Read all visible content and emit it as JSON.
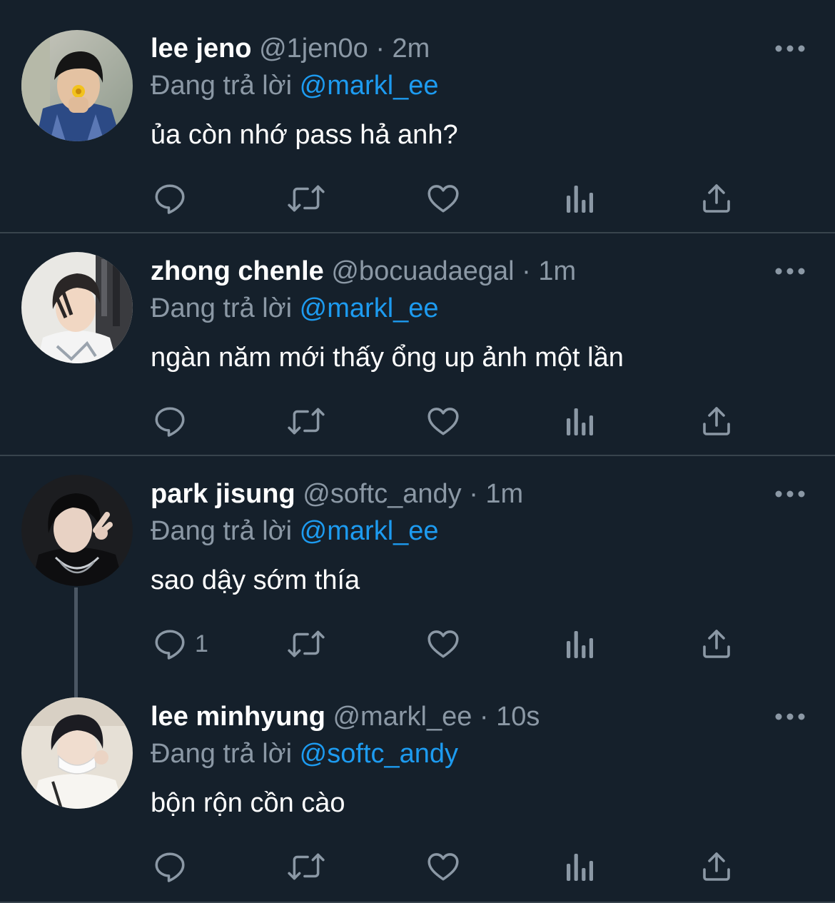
{
  "tweets": [
    {
      "name": "lee jeno",
      "handle": "@1jen0o",
      "dot": "·",
      "time": "2m",
      "reply_prefix": "Đang trả lời",
      "reply_to": "@markl_ee",
      "text": "ủa còn nhớ pass hả anh?",
      "reply_count": ""
    },
    {
      "name": "zhong chenle",
      "handle": "@bocuadaegal",
      "dot": "·",
      "time": "1m",
      "reply_prefix": "Đang trả lời",
      "reply_to": "@markl_ee",
      "text": "ngàn năm mới thấy ổng up ảnh một lần",
      "reply_count": ""
    },
    {
      "name": "park jisung",
      "handle": "@softc_andy",
      "dot": "·",
      "time": "1m",
      "reply_prefix": "Đang trả lời",
      "reply_to": "@markl_ee",
      "text": "sao dậy sớm thía",
      "reply_count": "1"
    },
    {
      "name": "lee minhyung",
      "handle": "@markl_ee",
      "dot": "·",
      "time": "10s",
      "reply_prefix": "Đang trả lời",
      "reply_to": "@softc_andy",
      "text": "bộn rộn cồn cào",
      "reply_count": ""
    }
  ],
  "icons": {
    "more": "more-horizontal-icon",
    "reply": "reply-icon",
    "retweet": "retweet-icon",
    "like": "heart-icon",
    "views": "views-icon",
    "share": "share-icon"
  },
  "colors": {
    "background": "#15202b",
    "text": "#ffffff",
    "secondary": "#8b98a5",
    "mention": "#1d9bf0",
    "separator": "#38444d",
    "thread_line": "#4a5663"
  }
}
